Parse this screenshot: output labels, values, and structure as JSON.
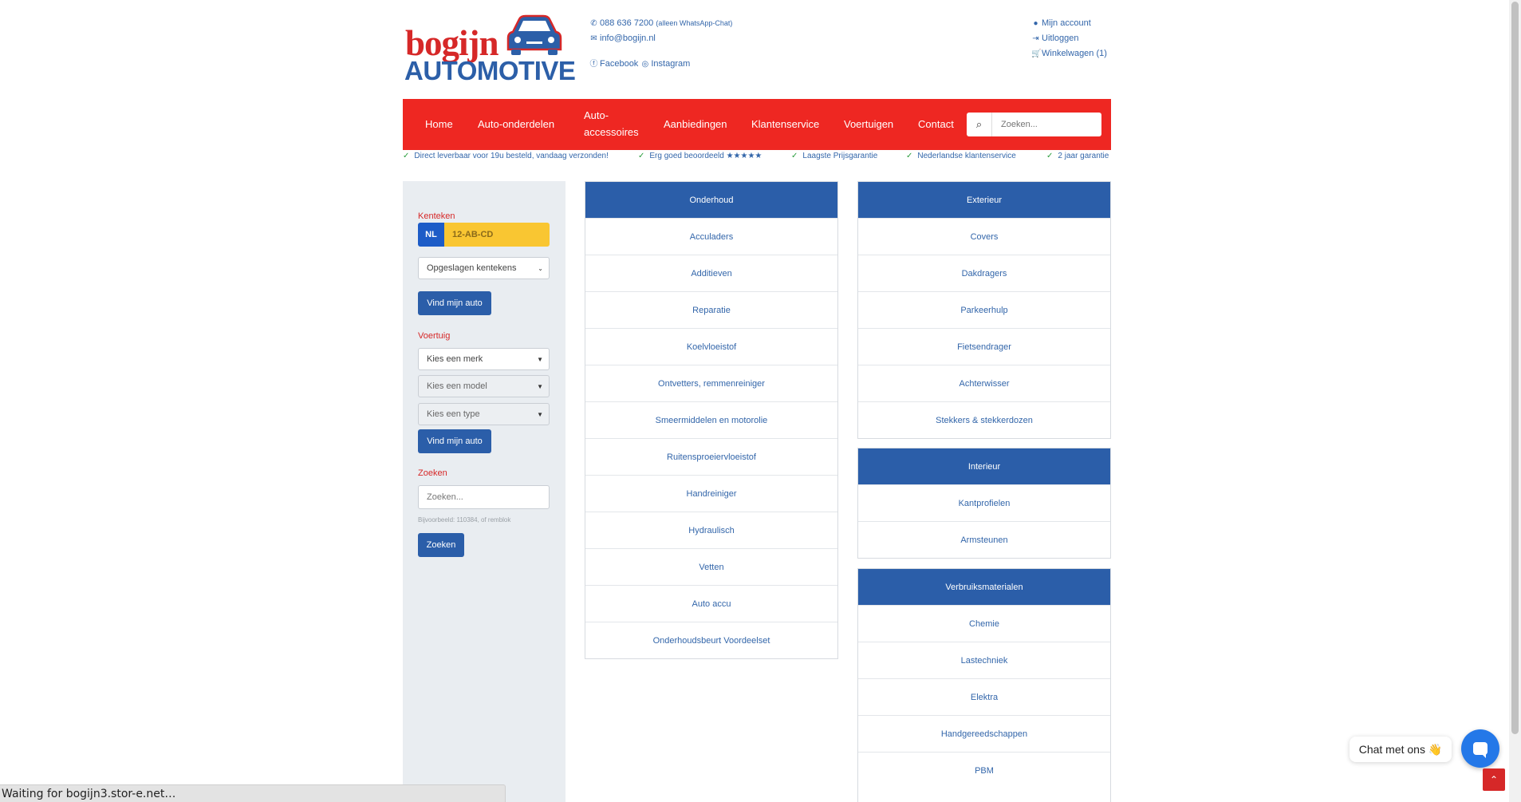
{
  "header": {
    "logo_word": "bogijn",
    "logo_sub": "AUTOMOTIVE",
    "phone": "088 636 7200",
    "phone_note": "(alleen WhatsApp-Chat)",
    "email": "info@bogijn.nl",
    "facebook": "Facebook",
    "instagram": "Instagram",
    "account": "Mijn account",
    "logout": "Uitloggen",
    "cart": "Winkelwagen (1)"
  },
  "nav": {
    "items": [
      "Home",
      "Auto-onderdelen",
      "Auto-",
      "accessoires",
      "Aanbiedingen",
      "Klantenservice",
      "Voertuigen",
      "Contact"
    ],
    "search_placeholder": "Zoeken..."
  },
  "usps": [
    "Direct leverbaar voor 19u besteld, vandaag verzonden!",
    "Erg goed beoordeeld ★★★★★",
    "Laagste Prijsgarantie",
    "Nederlandse klantenservice",
    "2 jaar garantie"
  ],
  "sidebar": {
    "kenteken_label": "Kenteken",
    "plate_country": "NL",
    "plate_placeholder": "12-AB-CD",
    "saved_plates": "Opgeslagen kentekens",
    "find_button": "Vind mijn auto",
    "voertuig_label": "Voertuig",
    "brand": "Kies een merk",
    "model": "Kies een model",
    "type": "Kies een type",
    "find_button_2": "Vind mijn auto",
    "zoeken_label": "Zoeken",
    "search_placeholder": "Zoeken...",
    "hint": "Bijvoorbeeld: 110384, of remblok",
    "search_button": "Zoeken"
  },
  "panels": {
    "onderhoud": {
      "title": "Onderhoud",
      "items": [
        "Acculaders",
        "Additieven",
        "Reparatie",
        "Koelvloeistof",
        "Ontvetters, remmenreiniger",
        "Smeermiddelen en motorolie",
        "Ruitensproeiervloeistof",
        "Handreiniger",
        "Hydraulisch",
        "Vetten",
        "Auto accu",
        "Onderhoudsbeurt Voordeelset"
      ]
    },
    "exterieur": {
      "title": "Exterieur",
      "items": [
        "Covers",
        "Dakdragers",
        "Parkeerhulp",
        "Fietsendrager",
        "Achterwisser",
        "Stekkers & stekkerdozen"
      ]
    },
    "interieur": {
      "title": "Interieur",
      "items": [
        "Kantprofielen",
        "Armsteunen"
      ]
    },
    "verbruik": {
      "title": "Verbruiksmaterialen",
      "items": [
        "Chemie",
        "Lastechniek",
        "Elektra",
        "Handgereedschappen",
        "PBM"
      ]
    }
  },
  "chat": {
    "label": "Chat met ons 👋"
  },
  "status_bar": "Waiting for bogijn3.stor-e.net…",
  "colors": {
    "brand_red": "#ee2722",
    "brand_blue": "#2b5ea9",
    "link": "#3366aa",
    "check": "#2a9d3c"
  }
}
